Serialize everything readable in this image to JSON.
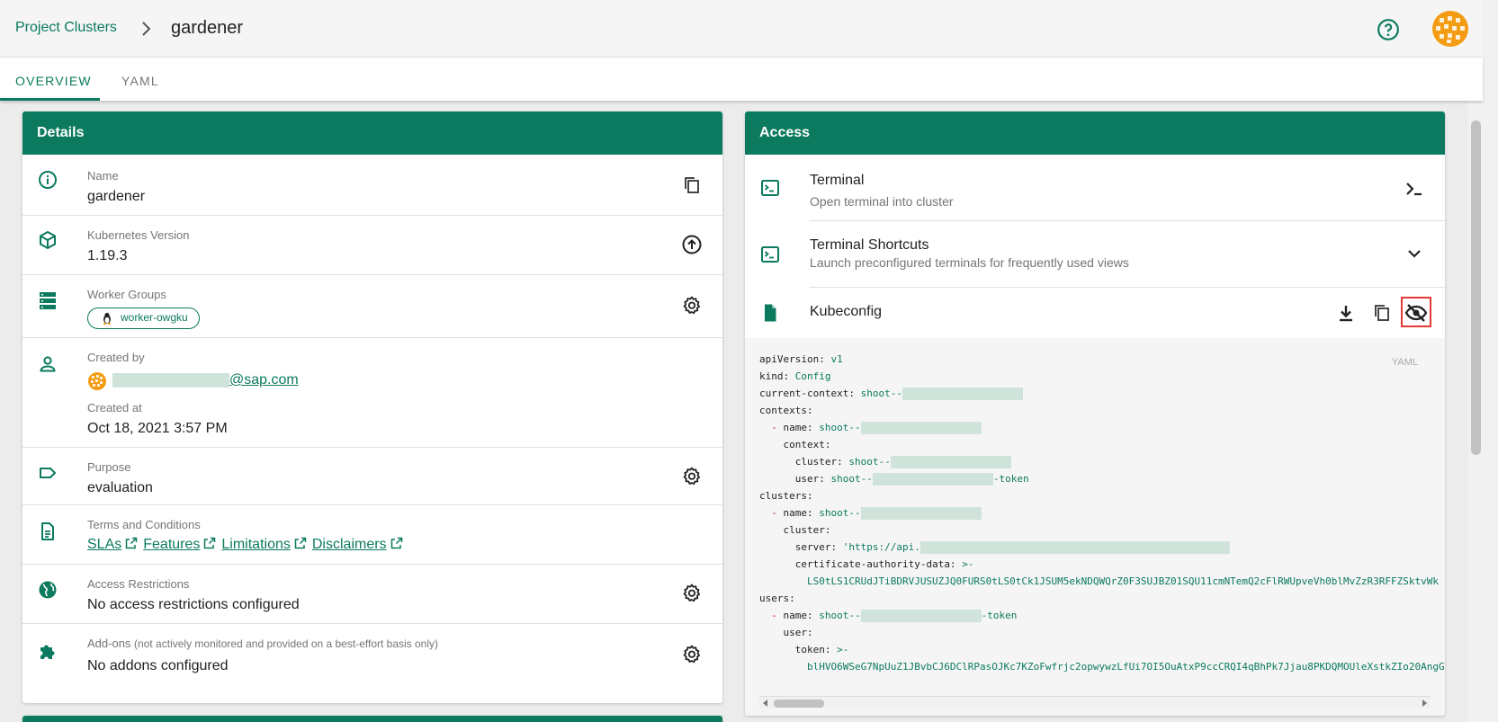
{
  "breadcrumb": {
    "parent": "Project Clusters",
    "current": "gardener"
  },
  "tabs": [
    {
      "label": "OVERVIEW",
      "active": true
    },
    {
      "label": "YAML",
      "active": false
    }
  ],
  "colors": {
    "accent": "#0b7a5e",
    "highlight": "#e53935"
  },
  "icons": {
    "help": "help-circle-icon",
    "avatar": "user-avatar-icon"
  },
  "details": {
    "title": "Details",
    "name": {
      "label": "Name",
      "value": "gardener"
    },
    "k8s": {
      "label": "Kubernetes Version",
      "value": "1.19.3"
    },
    "workers": {
      "label": "Worker Groups",
      "chip": "worker-owgku"
    },
    "created_by": {
      "label": "Created by",
      "email_suffix": "@sap.com"
    },
    "created_at": {
      "label": "Created at",
      "value": "Oct 18, 2021 3:57 PM"
    },
    "purpose": {
      "label": "Purpose",
      "value": "evaluation"
    },
    "terms": {
      "label": "Terms and Conditions",
      "links": [
        "SLAs",
        "Features",
        "Limitations",
        "Disclaimers"
      ]
    },
    "access_restrictions": {
      "label": "Access Restrictions",
      "value": "No access restrictions configured"
    },
    "addons": {
      "label": "Add-ons",
      "note": "(not actively monitored and provided on a best-effort basis only)",
      "value": "No addons configured"
    }
  },
  "access": {
    "title": "Access",
    "terminal": {
      "title": "Terminal",
      "subtitle": "Open terminal into cluster"
    },
    "shortcuts": {
      "title": "Terminal Shortcuts",
      "subtitle": "Launch preconfigured terminals for frequently used views"
    },
    "kubeconfig": {
      "title": "Kubeconfig"
    },
    "yaml_tag": "YAML",
    "code": {
      "apiVersion_k": "apiVersion:",
      "apiVersion_v": "v1",
      "kind_k": "kind:",
      "kind_v": "Config",
      "ctx_k": "current-context:",
      "shoot": "shoot--",
      "contexts_k": "contexts:",
      "name_k": "name:",
      "context_k": "context:",
      "cluster_k": "cluster:",
      "user_k": "user:",
      "token_suffix": "-token",
      "clusters_k": "clusters:",
      "server_k": "server:",
      "server_v": "'https://api.",
      "ca_k": "certificate-authority-data:",
      "block": ">-",
      "ca_v": "LS0tLS1CRUdJTiBDRVJUSUZJQ0FURS0tLS0tCk1JSUM5ekNDQWQrZ0F3SUJBZ01SQU11cmNTemQ2cFlRWUpveVh0blMvZzR3RFFZSktvWk",
      "users_k": "users:",
      "token_k": "token:",
      "token_v": "blHVO6WSeG7NpUuZ1JBvbCJ6DClRPasOJKc7KZoFwfrjc2opwywzLfUi7OI5OuAtxP9ccCRQI4qBhPk7Jjau8PKDQMOUleXstkZIo20AngG"
    }
  }
}
